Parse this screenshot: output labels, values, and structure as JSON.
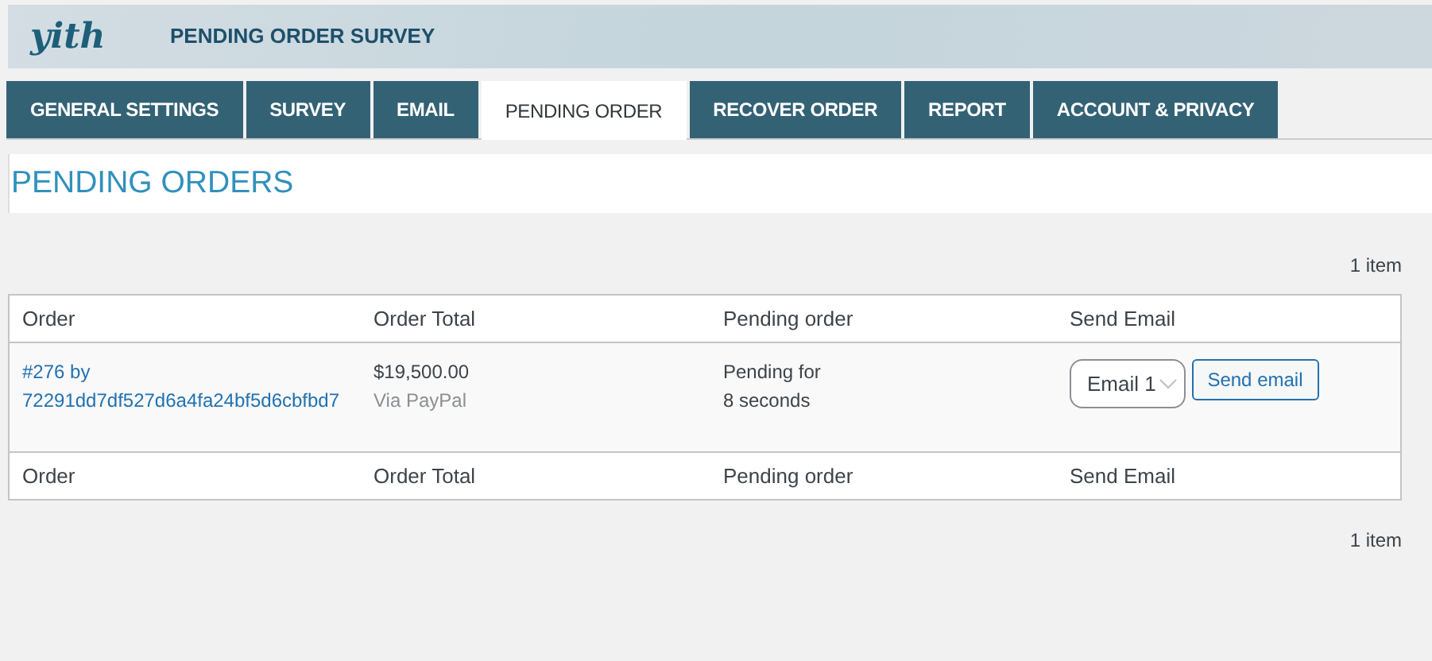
{
  "header": {
    "logo": "yith",
    "title": "PENDING ORDER SURVEY"
  },
  "tabs": [
    {
      "label": "GENERAL SETTINGS",
      "selected": false
    },
    {
      "label": "SURVEY",
      "selected": false
    },
    {
      "label": "EMAIL",
      "selected": false
    },
    {
      "label": "PENDING ORDER",
      "selected": true
    },
    {
      "label": "RECOVER ORDER",
      "selected": false
    },
    {
      "label": "REPORT",
      "selected": false
    },
    {
      "label": "ACCOUNT & PRIVACY",
      "selected": false
    }
  ],
  "page_title": "PENDING ORDERS",
  "item_count_top": "1 item",
  "table": {
    "columns": [
      "Order",
      "Order Total",
      "Pending order",
      "Send Email"
    ],
    "rows": [
      {
        "order_link": "#276 by 72291dd7df527d6a4fa24bf5d6cbfbd7",
        "total": "$19,500.00",
        "payment": "Via PayPal",
        "pending": [
          "Pending for",
          "8 seconds"
        ],
        "email_select": "Email 1",
        "send_button": "Send email"
      }
    ],
    "footer_columns": [
      "Order",
      "Order Total",
      "Pending order",
      "Send Email"
    ]
  },
  "item_count_bottom": "1 item"
}
